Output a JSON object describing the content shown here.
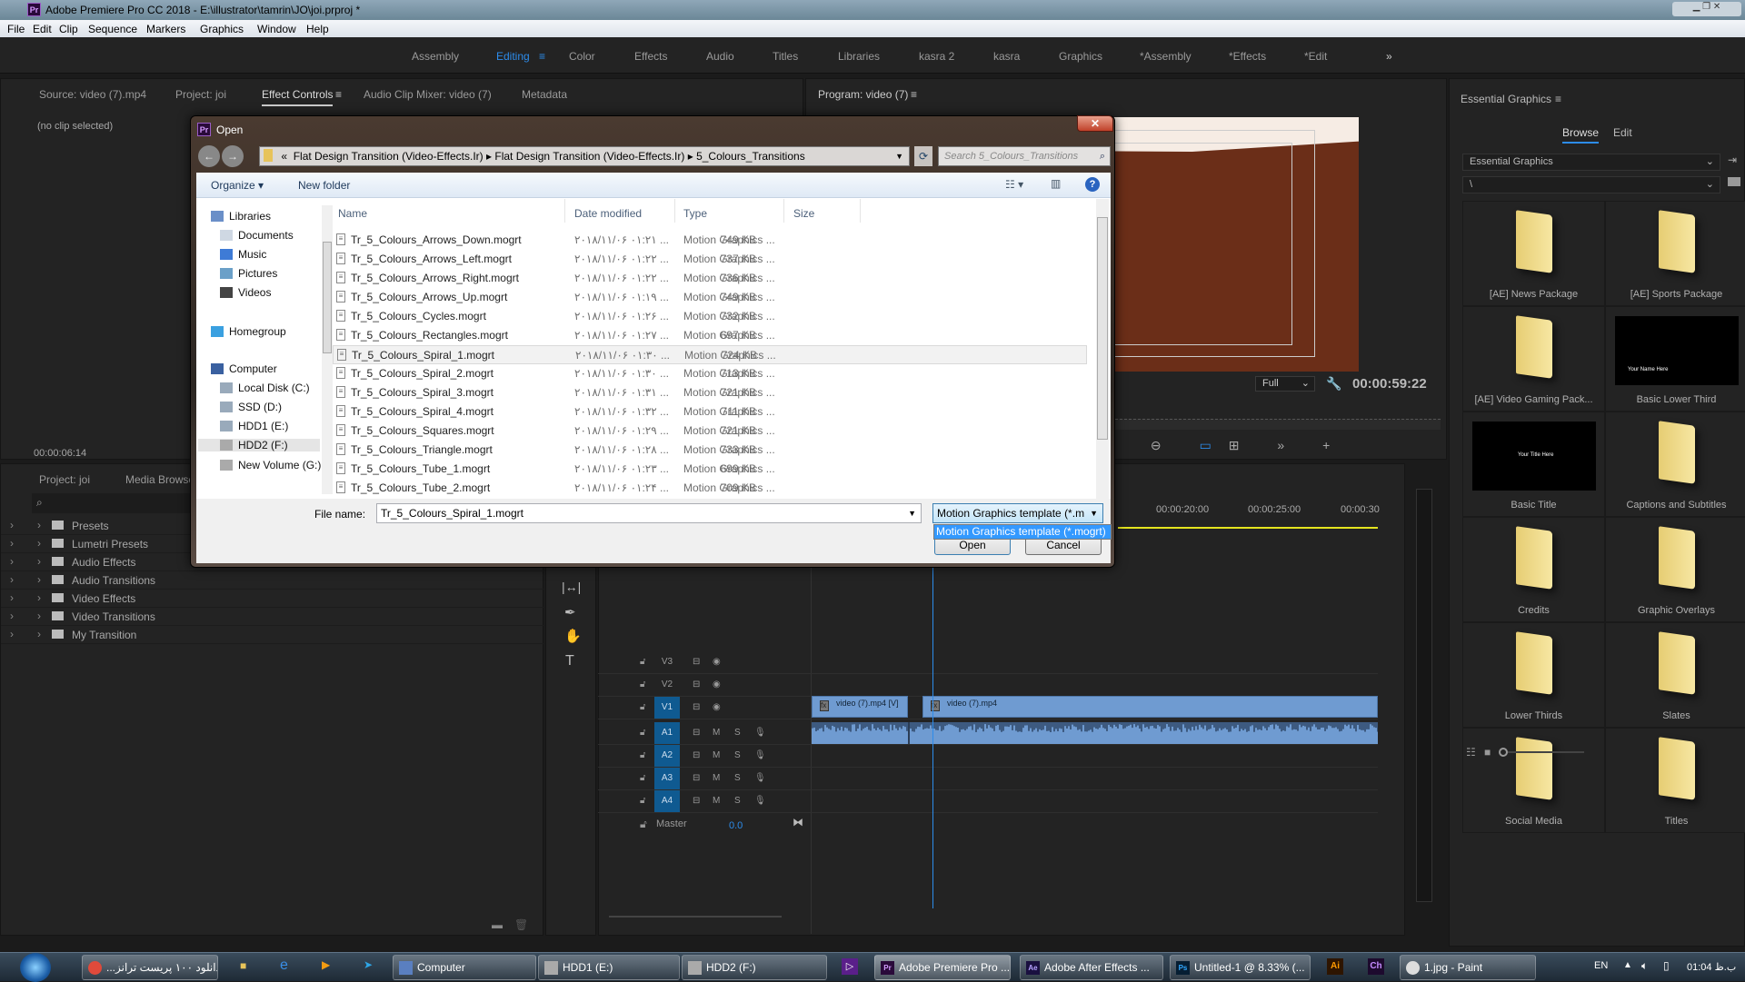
{
  "app": {
    "title": "Adobe Premiere Pro CC 2018 - E:\\illustrator\\tamrin\\JO\\joi.prproj *",
    "logo": "Pr"
  },
  "menu": [
    "File",
    "Edit",
    "Clip",
    "Sequence",
    "Markers",
    "Graphics",
    "Window",
    "Help"
  ],
  "workspaces": {
    "items": [
      "Assembly",
      "Editing",
      "Color",
      "Effects",
      "Audio",
      "Titles",
      "Libraries",
      "kasra 2",
      "kasra",
      "Graphics",
      "*Assembly",
      "*Effects",
      "*Edit"
    ],
    "active": "Editing",
    "overflow": "»"
  },
  "source_panel": {
    "tabs": [
      "Source: video (7).mp4",
      "Project: joi",
      "Effect Controls",
      "Audio Clip Mixer: video (7)",
      "Metadata"
    ],
    "active_tab": "Effect Controls",
    "message": "(no clip selected)",
    "timecode": "00:00:06:14"
  },
  "program_monitor": {
    "title": "Program: video (7)",
    "zoom": "Full",
    "timecode": "00:00:59:22"
  },
  "project_panel": {
    "tabs": [
      "Project: joi",
      "Media Browser"
    ],
    "tree": [
      "Presets",
      "Lumetri Presets",
      "Audio Effects",
      "Audio Transitions",
      "Video Effects",
      "Video Transitions",
      "My Transition"
    ]
  },
  "timeline": {
    "ruler": [
      "00:00:20:00",
      "00:00:25:00",
      "00:00:30"
    ],
    "tracks": [
      {
        "name": "V3",
        "type": "video"
      },
      {
        "name": "V2",
        "type": "video"
      },
      {
        "name": "V1",
        "type": "video"
      },
      {
        "name": "A1",
        "type": "audio"
      },
      {
        "name": "A2",
        "type": "audio"
      },
      {
        "name": "A3",
        "type": "audio"
      },
      {
        "name": "A4",
        "type": "audio"
      }
    ],
    "master": {
      "label": "Master",
      "value": "0.0"
    },
    "clips": [
      "video (7).mp4 [V]",
      "video (7).mp4"
    ],
    "mute": "M",
    "solo": "S"
  },
  "essential_graphics": {
    "title": "Essential Graphics",
    "tabs": [
      "Browse",
      "Edit"
    ],
    "active_tab": "Browse",
    "source_select": "Essential Graphics",
    "path_select": "\\",
    "items": [
      {
        "label": "[AE] News Package",
        "kind": "folder"
      },
      {
        "label": "[AE] Sports Package",
        "kind": "folder"
      },
      {
        "label": "[AE] Video Gaming Pack...",
        "kind": "folder"
      },
      {
        "label": "Basic Lower Third",
        "kind": "thumb",
        "thumb_text": "Your Name Here"
      },
      {
        "label": "Basic Title",
        "kind": "thumb",
        "thumb_text": "Your Title Here"
      },
      {
        "label": "Captions and Subtitles",
        "kind": "folder"
      },
      {
        "label": "Credits",
        "kind": "folder"
      },
      {
        "label": "Graphic Overlays",
        "kind": "folder"
      },
      {
        "label": "Lower Thirds",
        "kind": "folder"
      },
      {
        "label": "Slates",
        "kind": "folder"
      },
      {
        "label": "Social Media",
        "kind": "folder"
      },
      {
        "label": "Titles",
        "kind": "folder"
      }
    ]
  },
  "open_dialog": {
    "title": "Open",
    "breadcrumb": [
      "«",
      "Flat Design Transition (Video-Effects.Ir)",
      "Flat Design Transition (Video-Effects.Ir)",
      "5_Colours_Transitions"
    ],
    "search_placeholder": "Search 5_Colours_Transitions",
    "organize": "Organize ▾",
    "new_folder": "New folder",
    "columns": [
      "Name",
      "Date modified",
      "Type",
      "Size"
    ],
    "nav": [
      {
        "label": "Libraries",
        "indent": 0
      },
      {
        "label": "Documents",
        "indent": 1
      },
      {
        "label": "Music",
        "indent": 1
      },
      {
        "label": "Pictures",
        "indent": 1
      },
      {
        "label": "Videos",
        "indent": 1
      },
      {
        "label": "Homegroup",
        "indent": 0
      },
      {
        "label": "Computer",
        "indent": 0
      },
      {
        "label": "Local Disk (C:)",
        "indent": 1
      },
      {
        "label": "SSD (D:)",
        "indent": 1
      },
      {
        "label": "HDD1 (E:)",
        "indent": 1
      },
      {
        "label": "HDD2 (F:)",
        "indent": 1,
        "selected": true
      },
      {
        "label": "New Volume (G:)",
        "indent": 1
      }
    ],
    "files": [
      {
        "name": "Tr_5_Colours_Arrows_Down.mogrt",
        "date": "۲۰۱۸/۱۱/۰۶ ۰۱:۲۱ ...",
        "type": "Motion Graphics ...",
        "size": "749 KB"
      },
      {
        "name": "Tr_5_Colours_Arrows_Left.mogrt",
        "date": "۲۰۱۸/۱۱/۰۶ ۰۱:۲۲ ...",
        "type": "Motion Graphics ...",
        "size": "737 KB"
      },
      {
        "name": "Tr_5_Colours_Arrows_Right.mogrt",
        "date": "۲۰۱۸/۱۱/۰۶ ۰۱:۲۲ ...",
        "type": "Motion Graphics ...",
        "size": "736 KB"
      },
      {
        "name": "Tr_5_Colours_Arrows_Up.mogrt",
        "date": "۲۰۱۸/۱۱/۰۶ ۰۱:۱۹ ...",
        "type": "Motion Graphics ...",
        "size": "749 KB"
      },
      {
        "name": "Tr_5_Colours_Cycles.mogrt",
        "date": "۲۰۱۸/۱۱/۰۶ ۰۱:۲۶ ...",
        "type": "Motion Graphics ...",
        "size": "732 KB"
      },
      {
        "name": "Tr_5_Colours_Rectangles.mogrt",
        "date": "۲۰۱۸/۱۱/۰۶ ۰۱:۲۷ ...",
        "type": "Motion Graphics ...",
        "size": "697 KB"
      },
      {
        "name": "Tr_5_Colours_Spiral_1.mogrt",
        "date": "۲۰۱۸/۱۱/۰۶ ۰۱:۳۰ ...",
        "type": "Motion Graphics ...",
        "size": "724 KB",
        "selected": true
      },
      {
        "name": "Tr_5_Colours_Spiral_2.mogrt",
        "date": "۲۰۱۸/۱۱/۰۶ ۰۱:۳۰ ...",
        "type": "Motion Graphics ...",
        "size": "713 KB"
      },
      {
        "name": "Tr_5_Colours_Spiral_3.mogrt",
        "date": "۲۰۱۸/۱۱/۰۶ ۰۱:۳۱ ...",
        "type": "Motion Graphics ...",
        "size": "721 KB"
      },
      {
        "name": "Tr_5_Colours_Spiral_4.mogrt",
        "date": "۲۰۱۸/۱۱/۰۶ ۰۱:۳۲ ...",
        "type": "Motion Graphics ...",
        "size": "711 KB"
      },
      {
        "name": "Tr_5_Colours_Squares.mogrt",
        "date": "۲۰۱۸/۱۱/۰۶ ۰۱:۲۹ ...",
        "type": "Motion Graphics ...",
        "size": "721 KB"
      },
      {
        "name": "Tr_5_Colours_Triangle.mogrt",
        "date": "۲۰۱۸/۱۱/۰۶ ۰۱:۲۸ ...",
        "type": "Motion Graphics ...",
        "size": "733 KB"
      },
      {
        "name": "Tr_5_Colours_Tube_1.mogrt",
        "date": "۲۰۱۸/۱۱/۰۶ ۰۱:۲۳ ...",
        "type": "Motion Graphics ...",
        "size": "699 KB"
      },
      {
        "name": "Tr_5_Colours_Tube_2.mogrt",
        "date": "۲۰۱۸/۱۱/۰۶ ۰۱:۲۴ ...",
        "type": "Motion Graphics ...",
        "size": "709 KB"
      }
    ],
    "file_name_label": "File name:",
    "file_name_value": "Tr_5_Colours_Spiral_1.mogrt",
    "filter_value": "Motion Graphics template (*.m",
    "filter_option": "Motion Graphics template (*.mogrt)",
    "open_button": "Open",
    "cancel_button": "Cancel"
  },
  "taskbar": {
    "items": [
      {
        "label": "...دانلود ۱۰۰ پریست ترانز",
        "icon": "chrome"
      },
      {
        "label": "Computer",
        "icon": "computer"
      },
      {
        "label": "HDD1 (E:)",
        "icon": "drive"
      },
      {
        "label": "HDD2 (F:)",
        "icon": "drive"
      },
      {
        "label": "Adobe Premiere Pro ...",
        "icon": "Pr"
      },
      {
        "label": "Adobe After Effects ...",
        "icon": "Ae"
      },
      {
        "label": "Untitled-1 @ 8.33% (...",
        "icon": "Ps"
      },
      {
        "label": "1.jpg - Paint",
        "icon": "paint"
      }
    ],
    "pinned": [
      "Ai",
      "Ch"
    ],
    "language": "EN",
    "clock": "01:04 ب.ظ"
  },
  "colors": {
    "accent": "#2d8ceb",
    "track_active": "#0f5a91",
    "clip": "#6f9bd1",
    "video_frame": "#6b2e18",
    "ruler_yellow": "#e5e51f"
  }
}
